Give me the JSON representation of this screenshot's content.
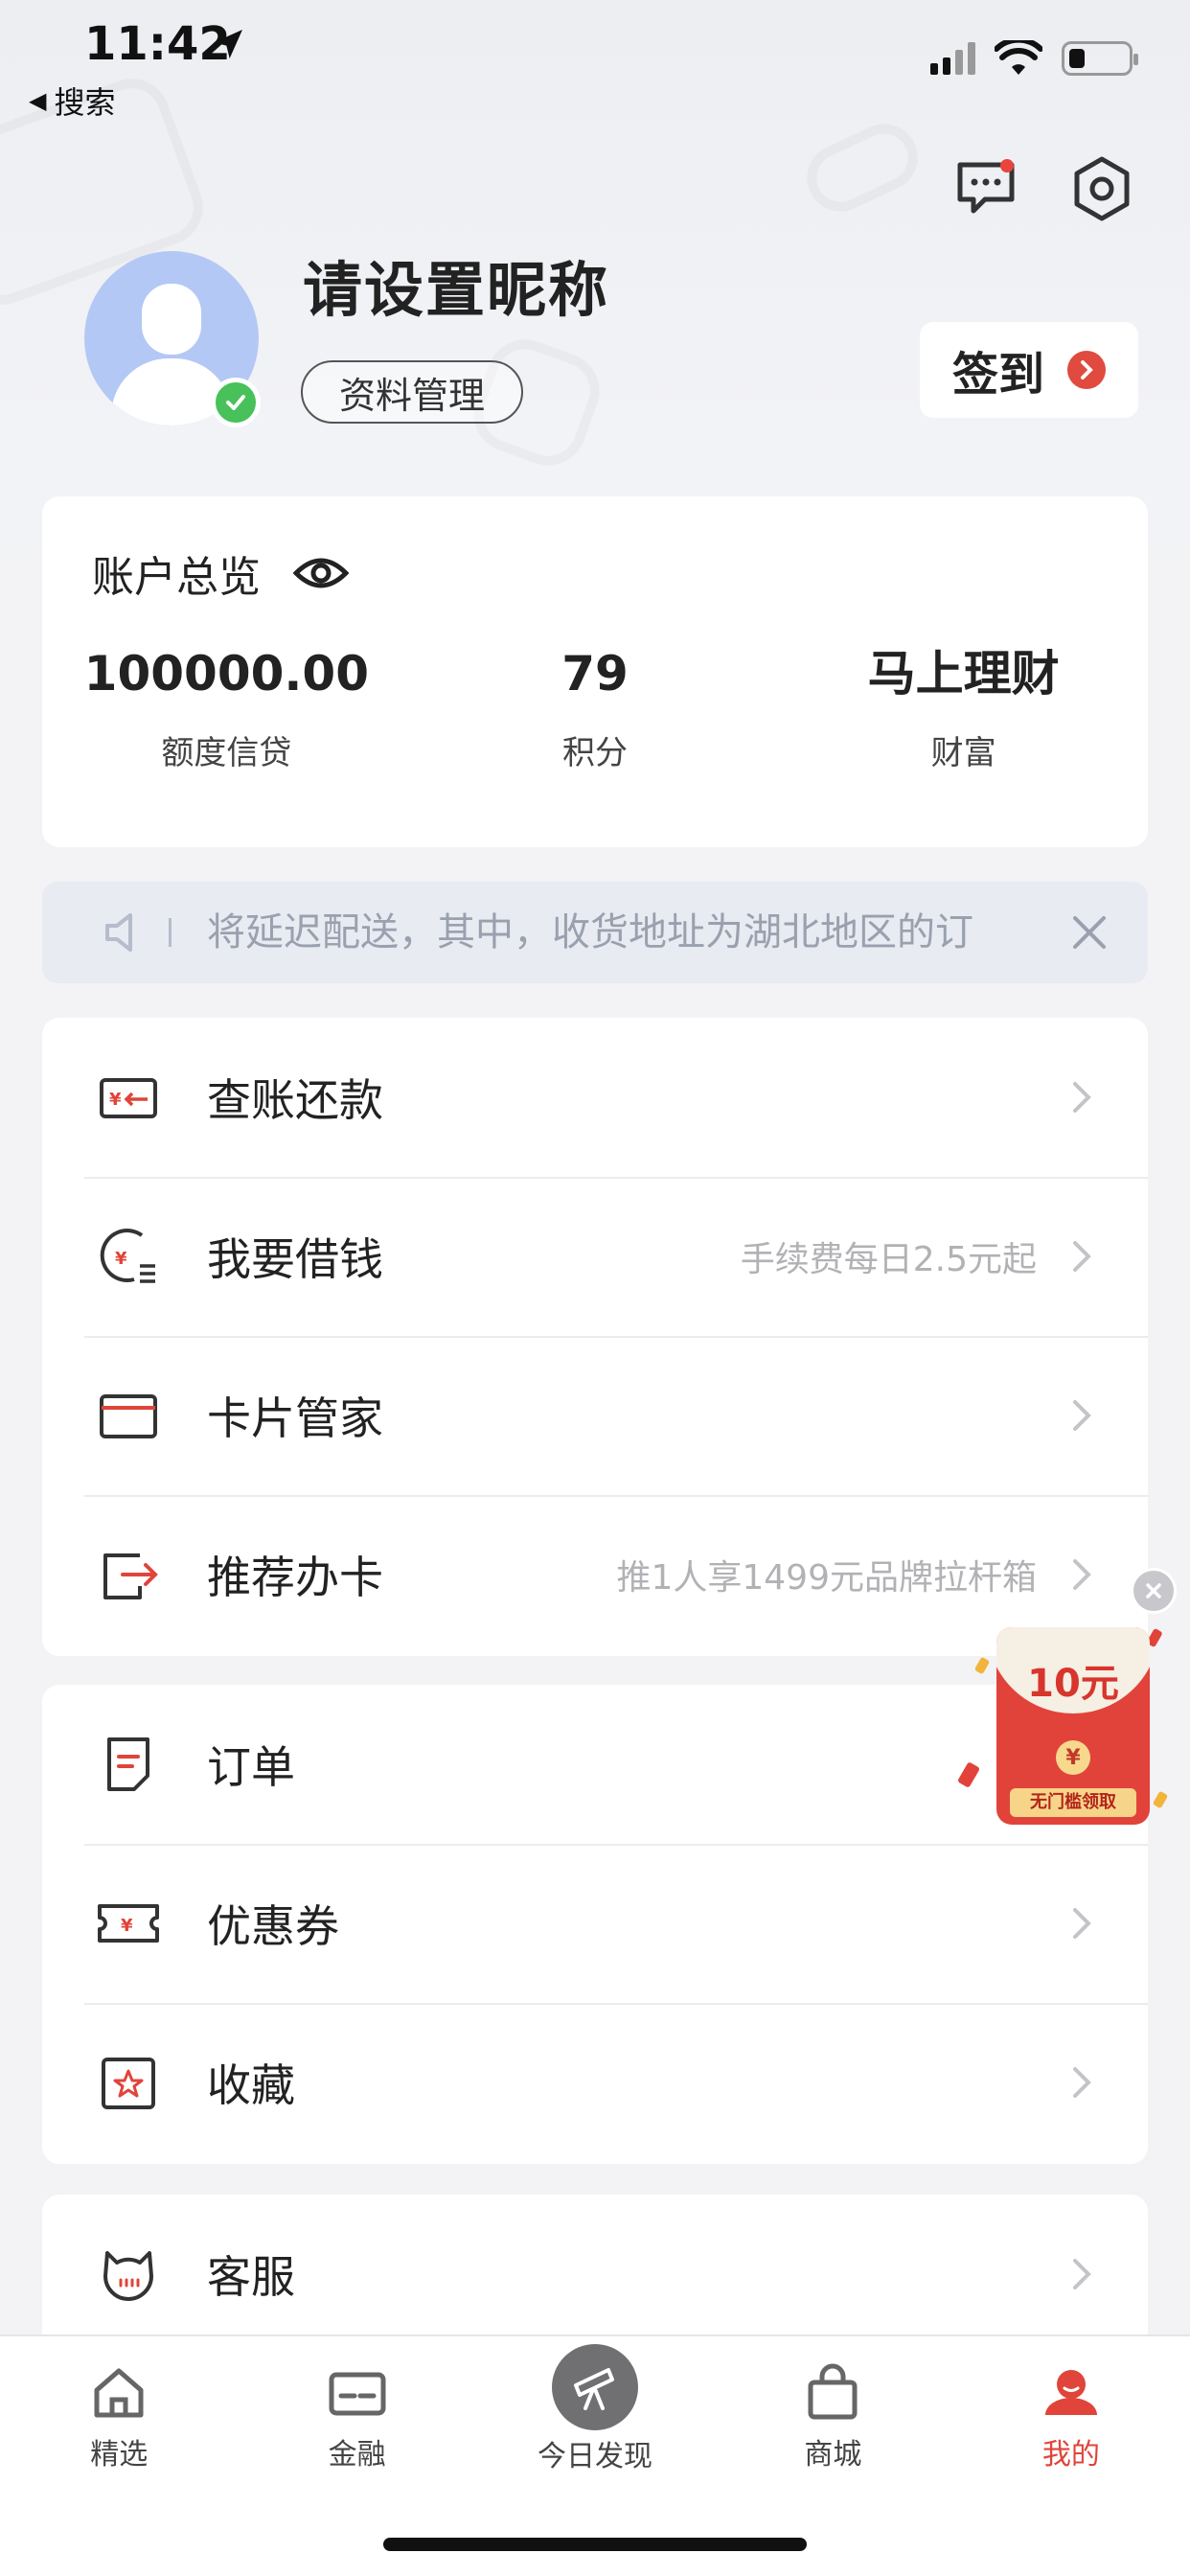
{
  "status_bar": {
    "time": "11:42",
    "back_label": "搜索"
  },
  "colors": {
    "accent": "#e0443a",
    "verified": "#48c15b",
    "avatar_bg": "#b4c8f5"
  },
  "profile": {
    "nickname": "请设置昵称",
    "profile_button": "资料管理",
    "checkin_label": "签到"
  },
  "account_overview": {
    "title": "账户总览",
    "stats": [
      {
        "value": "100000.00",
        "label": "额度信贷"
      },
      {
        "value": "79",
        "label": "积分"
      },
      {
        "value": "马上理财",
        "label": "财富"
      }
    ]
  },
  "notice": {
    "text": "将延迟配送，其中，收货地址为湖北地区的订"
  },
  "menu_group_1": [
    {
      "label": "查账还款",
      "sub": "",
      "icon": "bill-icon"
    },
    {
      "label": "我要借钱",
      "sub": "手续费每日2.5元起",
      "icon": "borrow-icon"
    },
    {
      "label": "卡片管家",
      "sub": "",
      "icon": "card-icon"
    },
    {
      "label": "推荐办卡",
      "sub": "推1人享1499元品牌拉杆箱",
      "icon": "share-icon"
    }
  ],
  "menu_group_2": [
    {
      "label": "订单",
      "sub": "",
      "icon": "order-icon"
    },
    {
      "label": "优惠券",
      "sub": "",
      "icon": "coupon-icon"
    },
    {
      "label": "收藏",
      "sub": "",
      "icon": "favorite-icon"
    }
  ],
  "menu_group_3": [
    {
      "label": "客服",
      "sub": "",
      "icon": "customer-service-icon"
    }
  ],
  "promo": {
    "amount": "10元",
    "coin": "¥",
    "ribbon": "无门槛领取"
  },
  "tabbar": [
    {
      "label": "精选",
      "icon": "home-icon"
    },
    {
      "label": "金融",
      "icon": "finance-card-icon"
    },
    {
      "label": "今日发现",
      "icon": "telescope-icon"
    },
    {
      "label": "商城",
      "icon": "shopping-bag-icon"
    },
    {
      "label": "我的",
      "icon": "profile-icon",
      "active": true
    }
  ]
}
